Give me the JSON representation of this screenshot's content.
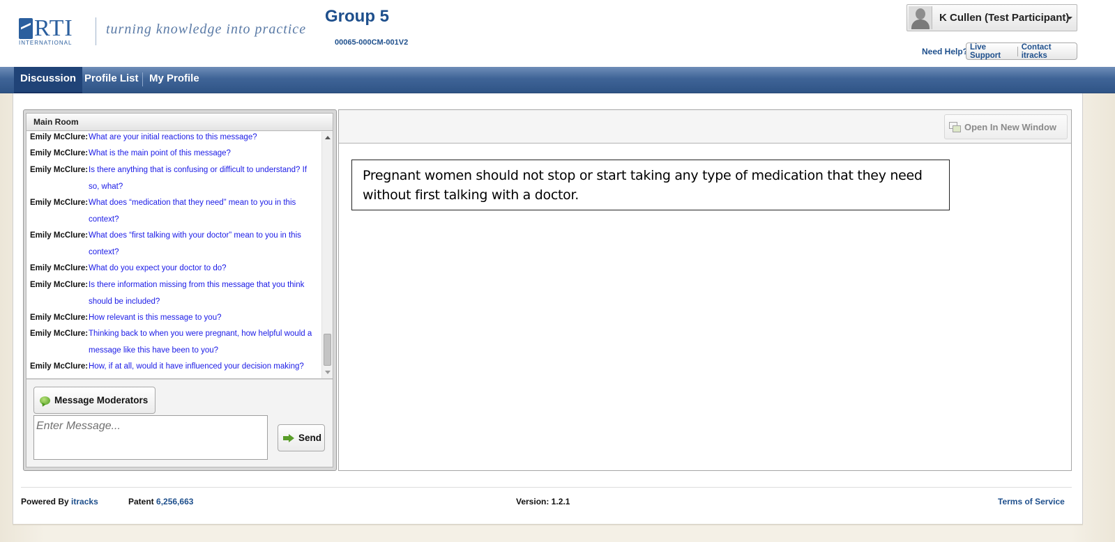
{
  "header": {
    "logo_text": "RTI",
    "logo_subtext": "INTERNATIONAL",
    "tagline": "turning knowledge into practice",
    "group_title": "Group 5",
    "project_code": "00065-000CM-001V2",
    "user_name": "K Cullen (Test Participant)",
    "need_help": "Need Help?",
    "live_support": "Live Support",
    "contact": "Contact itracks"
  },
  "nav": {
    "tabs": [
      {
        "label": "Discussion",
        "active": true
      },
      {
        "label": "Profile List",
        "active": false
      },
      {
        "label": "My Profile",
        "active": false
      }
    ]
  },
  "chat": {
    "room_name": "Main Room",
    "messages": [
      {
        "author": "Emily McClure:",
        "text": "What are your initial reactions to this message?"
      },
      {
        "author": "Emily McClure:",
        "text": "What is the main point of this message?"
      },
      {
        "author": "Emily McClure:",
        "text": "Is there anything that is confusing or difficult to understand? If so, what?"
      },
      {
        "author": "Emily McClure:",
        "text": "What does “medication that they need” mean to you in this context?"
      },
      {
        "author": "Emily McClure:",
        "text": "What does “first talking with your doctor” mean to you in this context?"
      },
      {
        "author": "Emily McClure:",
        "text": "What do you expect your doctor to do?"
      },
      {
        "author": "Emily McClure:",
        "text": "Is there information missing from this message that you think should be included?"
      },
      {
        "author": "Emily McClure:",
        "text": "How relevant is this message to you?"
      },
      {
        "author": "Emily McClure:",
        "text": "Thinking back to when you were pregnant, how helpful would a message like this have been to you?"
      },
      {
        "author": "Emily McClure:",
        "text": "How, if at all, would it have influenced your decision making?"
      }
    ],
    "message_moderators_label": "Message Moderators",
    "input_placeholder": "Enter Message...",
    "send_label": "Send"
  },
  "content": {
    "open_new_window_label": "Open In New Window",
    "message_text": "Pregnant women should not stop or start taking any type of medication that they need without first talking with a doctor."
  },
  "footer": {
    "powered_by_label": "Powered By",
    "powered_by_link": "itracks",
    "patent_label": "Patent",
    "patent_number": "6,256,663",
    "version": "Version: 1.2.1",
    "terms": "Terms of Service"
  },
  "colors": {
    "brand_blue": "#1e4f8c",
    "nav_blue": "#3f6497",
    "message_text_blue": "#1a1ae6"
  },
  "icons": {
    "user": "user-avatar-icon",
    "caret": "chevron-down-icon",
    "moderators": "chat-bubble-icon",
    "send": "arrow-right-icon",
    "open_window": "new-window-icon"
  }
}
